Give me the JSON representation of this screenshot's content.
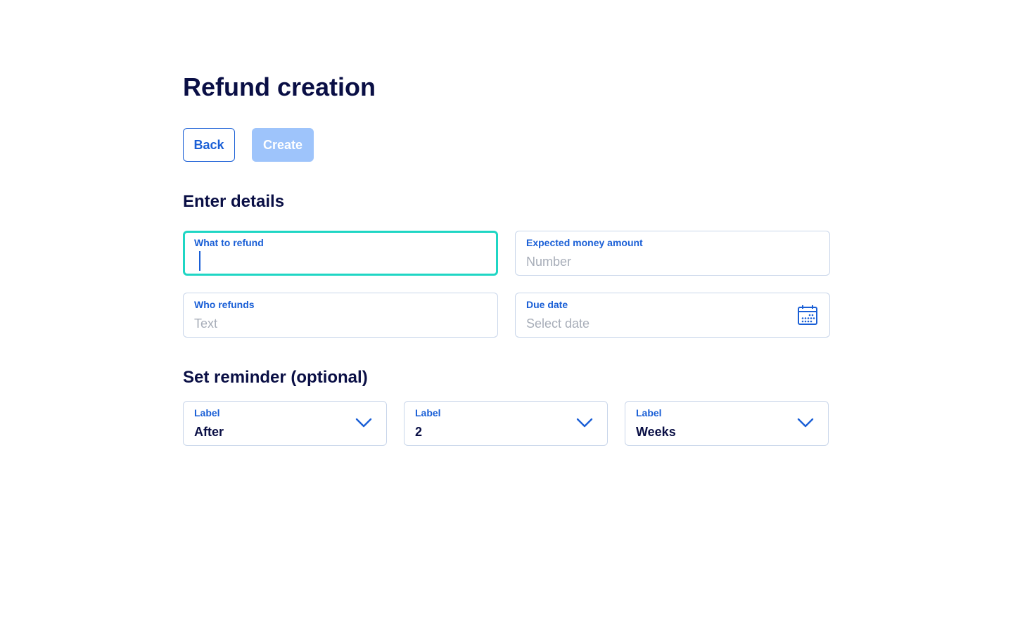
{
  "page": {
    "title": "Refund creation"
  },
  "actions": {
    "back_label": "Back",
    "create_label": "Create"
  },
  "details": {
    "section_title": "Enter details",
    "what_to_refund": {
      "label": "What to refund",
      "value": ""
    },
    "expected_amount": {
      "label": "Expected money amount",
      "placeholder": "Number"
    },
    "who_refunds": {
      "label": "Who refunds",
      "placeholder": "Text"
    },
    "due_date": {
      "label": "Due date",
      "placeholder": "Select date",
      "icon": "calendar-icon"
    }
  },
  "reminder": {
    "section_title": "Set reminder (optional)",
    "selects": [
      {
        "label": "Label",
        "value": "After",
        "icon": "chevron-down-icon"
      },
      {
        "label": "Label",
        "value": "2",
        "icon": "chevron-down-icon"
      },
      {
        "label": "Label",
        "value": "Weeks",
        "icon": "chevron-down-icon"
      }
    ]
  },
  "colors": {
    "title": "#0a0f45",
    "accent": "#1a5fd6",
    "disabled_button": "#9ec4fb",
    "focus_border": "#1fd6c4",
    "field_border": "#c9d6ea",
    "placeholder": "#a7adb8"
  }
}
